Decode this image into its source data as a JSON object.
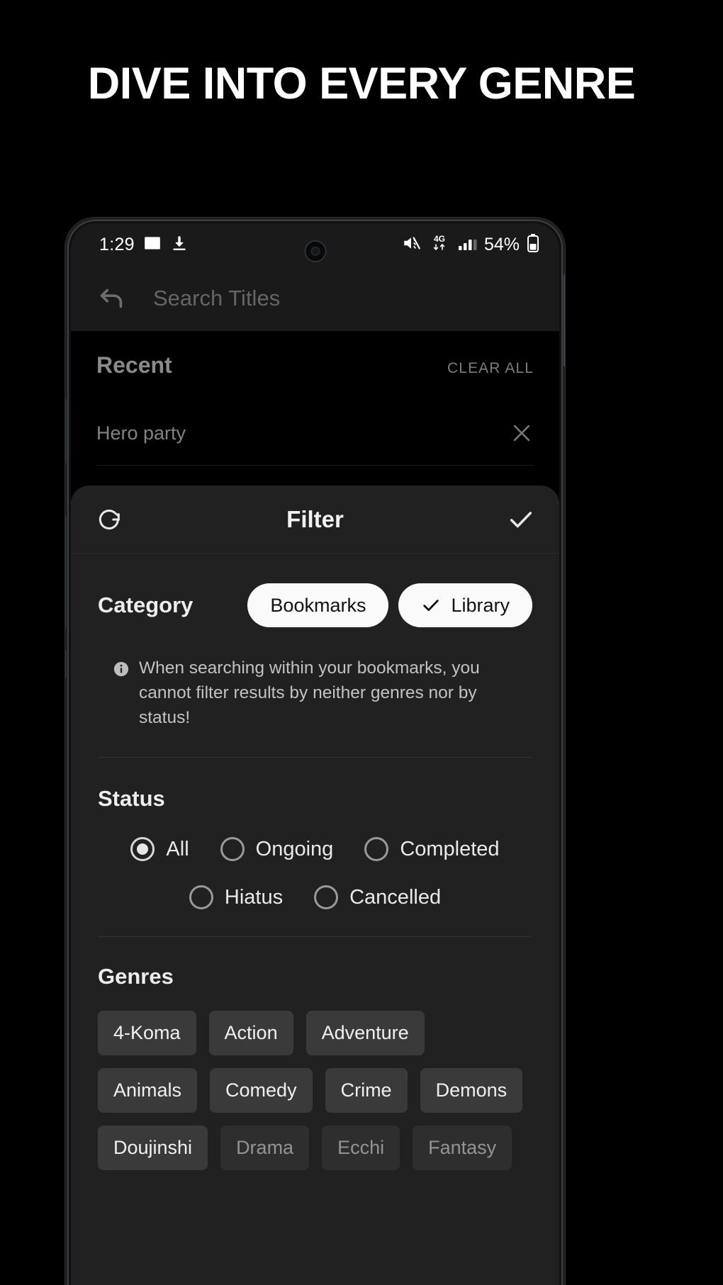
{
  "headline": "DIVE INTO EVERY GENRE",
  "status_bar": {
    "time": "1:29",
    "battery_percent": "54%",
    "network": "4G",
    "icons": [
      "image-icon",
      "download-icon",
      "mute-icon",
      "network-4g-icon",
      "signal-bars-icon",
      "battery-icon"
    ]
  },
  "search": {
    "placeholder": "Search Titles",
    "value": "",
    "back_icon": "back-arrow-icon"
  },
  "recent": {
    "title": "Recent",
    "clear_all_label": "CLEAR ALL",
    "items": [
      {
        "text": "Hero party",
        "remove_icon": "close-icon"
      }
    ]
  },
  "filter_sheet": {
    "title": "Filter",
    "reset_icon": "refresh-icon",
    "apply_icon": "check-icon",
    "category": {
      "label": "Category",
      "options": [
        {
          "label": "Bookmarks",
          "selected": false
        },
        {
          "label": "Library",
          "selected": true
        }
      ]
    },
    "info": {
      "icon": "info-icon",
      "text": "When searching within your bookmarks, you cannot filter results by neither genres nor by status!"
    },
    "status": {
      "label": "Status",
      "rows": [
        [
          {
            "label": "All",
            "selected": true
          },
          {
            "label": "Ongoing",
            "selected": false
          },
          {
            "label": "Completed",
            "selected": false
          }
        ],
        [
          {
            "label": "Hiatus",
            "selected": false
          },
          {
            "label": "Cancelled",
            "selected": false
          }
        ]
      ]
    },
    "genres": {
      "label": "Genres",
      "rows": [
        [
          "4-Koma",
          "Action",
          "Adventure",
          "Animals"
        ],
        [
          "Comedy",
          "Crime",
          "Demons",
          "Doujinshi"
        ],
        [
          "Drama",
          "Ecchi",
          "Fantasy"
        ]
      ]
    }
  },
  "colors": {
    "background": "#000000",
    "sheet": "#212121",
    "pill_selected": "#fafafa",
    "chip": "#3a3a3a",
    "text_primary": "#ffffff",
    "text_muted": "#8a8a8a"
  }
}
